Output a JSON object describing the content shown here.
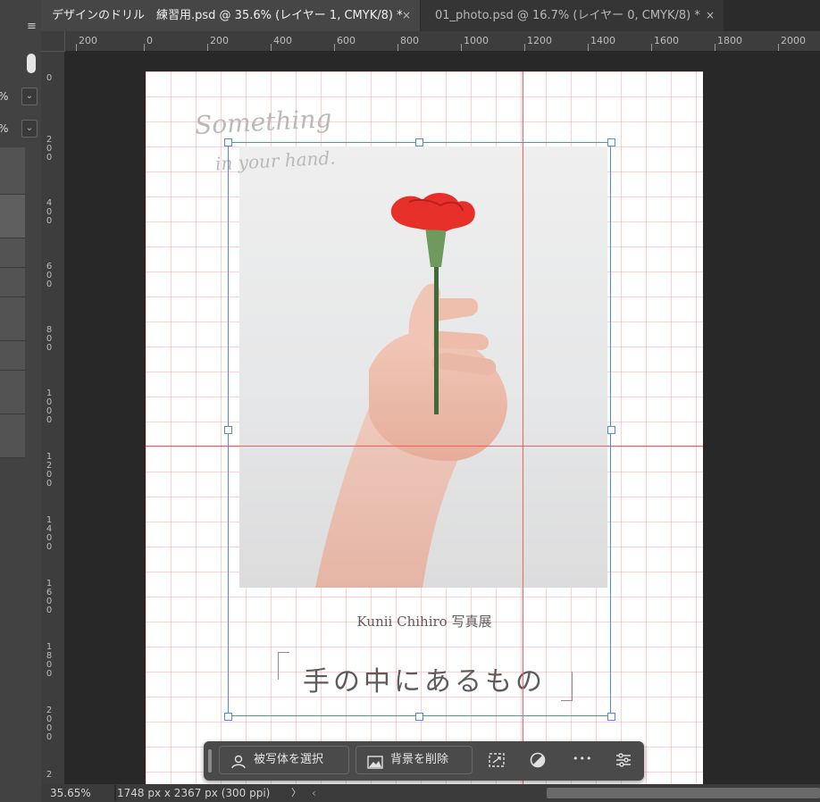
{
  "tabs": [
    {
      "label": "デザインのドリル　練習用.psd @ 35.6% (レイヤー 1, CMYK/8) *",
      "active": true
    },
    {
      "label": "01_photo.psd @ 16.7% (レイヤー 0, CMYK/8) *",
      "active": false
    }
  ],
  "tab_close_glyph": "×",
  "left_panel": {
    "menu_glyph": "≡",
    "pct_1": "%",
    "pct_2": "%",
    "dropdown_glyph": "⌄"
  },
  "ruler_h_labels": [
    "200",
    "0",
    "200",
    "400",
    "600",
    "800",
    "1000",
    "1200",
    "1400",
    "1600",
    "1800",
    "2000"
  ],
  "ruler_v_labels": [
    "0",
    "200",
    "400",
    "600",
    "800",
    "1000",
    "1200",
    "1400",
    "1600",
    "1800",
    "2000",
    "2"
  ],
  "poster": {
    "script_line1": "Something",
    "script_line2": "in your hand.",
    "artist_line": "Kunii Chihiro 写真展",
    "title": "手の中にあるもの"
  },
  "context_bar": {
    "select_subject": "被写体を選択",
    "remove_background": "背景を削除",
    "more_glyph": "•••",
    "icons": [
      "person-select-icon",
      "image-icon",
      "transform-icon",
      "adjust-icon",
      "more-icon",
      "settings-sliders-icon"
    ]
  },
  "status": {
    "zoom": "35.65%",
    "doc_info": "1748 px x 2367 px (300 ppi)",
    "arrow_glyph": "〉",
    "scroll_left_glyph": "‹"
  },
  "colors": {
    "guide": "#ff5a5a",
    "selection": "#4a8af4",
    "flower": "#e8302a",
    "stem": "#3f6b3a"
  }
}
